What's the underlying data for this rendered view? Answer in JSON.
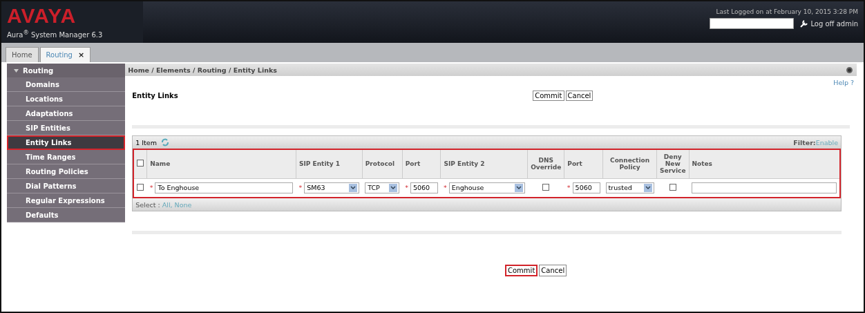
{
  "header": {
    "logo": "AVAYA",
    "product": "Aura",
    "product_mark": "®",
    "product_rest": "System Manager 6.3",
    "last_login": "Last Logged on at February 10, 2015 3:28 PM",
    "logoff": "Log off admin"
  },
  "tabs": [
    {
      "label": "Home",
      "selected": false
    },
    {
      "label": "Routing",
      "selected": true,
      "close": "×"
    }
  ],
  "sidebar": {
    "title": "Routing",
    "expanded": true,
    "items": [
      {
        "label": "Domains",
        "selected": false
      },
      {
        "label": "Locations",
        "selected": false
      },
      {
        "label": "Adaptations",
        "selected": false
      },
      {
        "label": "SIP Entities",
        "selected": false
      },
      {
        "label": "Entity Links",
        "selected": true
      },
      {
        "label": "Time Ranges",
        "selected": false
      },
      {
        "label": "Routing Policies",
        "selected": false
      },
      {
        "label": "Dial Patterns",
        "selected": false
      },
      {
        "label": "Regular Expressions",
        "selected": false
      },
      {
        "label": "Defaults",
        "selected": false
      }
    ]
  },
  "breadcrumb": "Home / Elements / Routing / Entity Links",
  "help": "Help ?",
  "page_title": "Entity Links",
  "top_buttons": [
    {
      "label": "Commit",
      "highlighted": false
    },
    {
      "label": "Cancel",
      "highlighted": false
    }
  ],
  "table": {
    "count": "1 Item",
    "filter_label": "Filter:",
    "filter_link": "Enable",
    "highlighted": true,
    "columns": [
      {
        "kind": "check",
        "checked": false
      },
      {
        "label": "Name"
      },
      {
        "label": "SIP Entity 1"
      },
      {
        "label": "Protocol"
      },
      {
        "label": "Port"
      },
      {
        "label": "SIP Entity 2"
      },
      {
        "label": "DNS Override"
      },
      {
        "label": "Port"
      },
      {
        "label": "Connection Policy"
      },
      {
        "label": "Deny New Service"
      },
      {
        "label": "Notes"
      }
    ],
    "rows": [
      {
        "cells": [
          {
            "kind": "check",
            "checked": false
          },
          {
            "kind": "text",
            "required": "*",
            "value": "To Enghouse"
          },
          {
            "kind": "select",
            "required": "*",
            "value": "SM63"
          },
          {
            "kind": "select",
            "value": "TCP"
          },
          {
            "kind": "text",
            "required": "*",
            "value": "5060"
          },
          {
            "kind": "select",
            "required": "*",
            "value": "Enghouse"
          },
          {
            "kind": "check",
            "checked": false
          },
          {
            "kind": "text",
            "required": "*",
            "value": "5060"
          },
          {
            "kind": "select",
            "value": "trusted"
          },
          {
            "kind": "check",
            "checked": false
          },
          {
            "kind": "text"
          }
        ]
      }
    ],
    "select_label": "Select :",
    "select_links": [
      "All",
      "None"
    ],
    "select_separator": ","
  },
  "bottom_buttons": [
    {
      "label": "Commit",
      "highlighted": true
    },
    {
      "label": "Cancel",
      "highlighted": false
    }
  ]
}
